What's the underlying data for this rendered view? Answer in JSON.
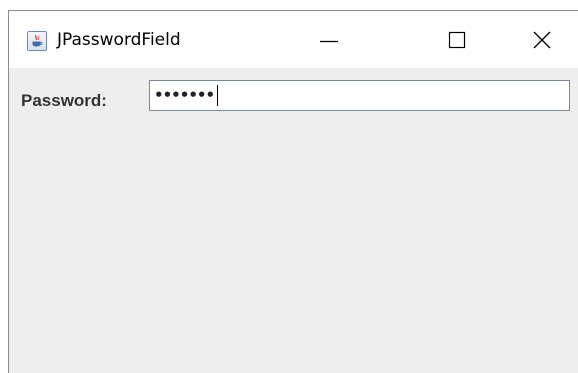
{
  "window": {
    "title": "JPasswordField",
    "icon": "java-cup-icon",
    "controls": {
      "minimize_icon": "minimize-icon",
      "maximize_icon": "maximize-icon",
      "close_icon": "close-icon"
    }
  },
  "form": {
    "password_label": "Password:",
    "password_masked": "•••••••"
  },
  "colors": {
    "content_background": "#eeeeee",
    "titlebar_background": "#ffffff",
    "field_border": "#7a8a99"
  }
}
